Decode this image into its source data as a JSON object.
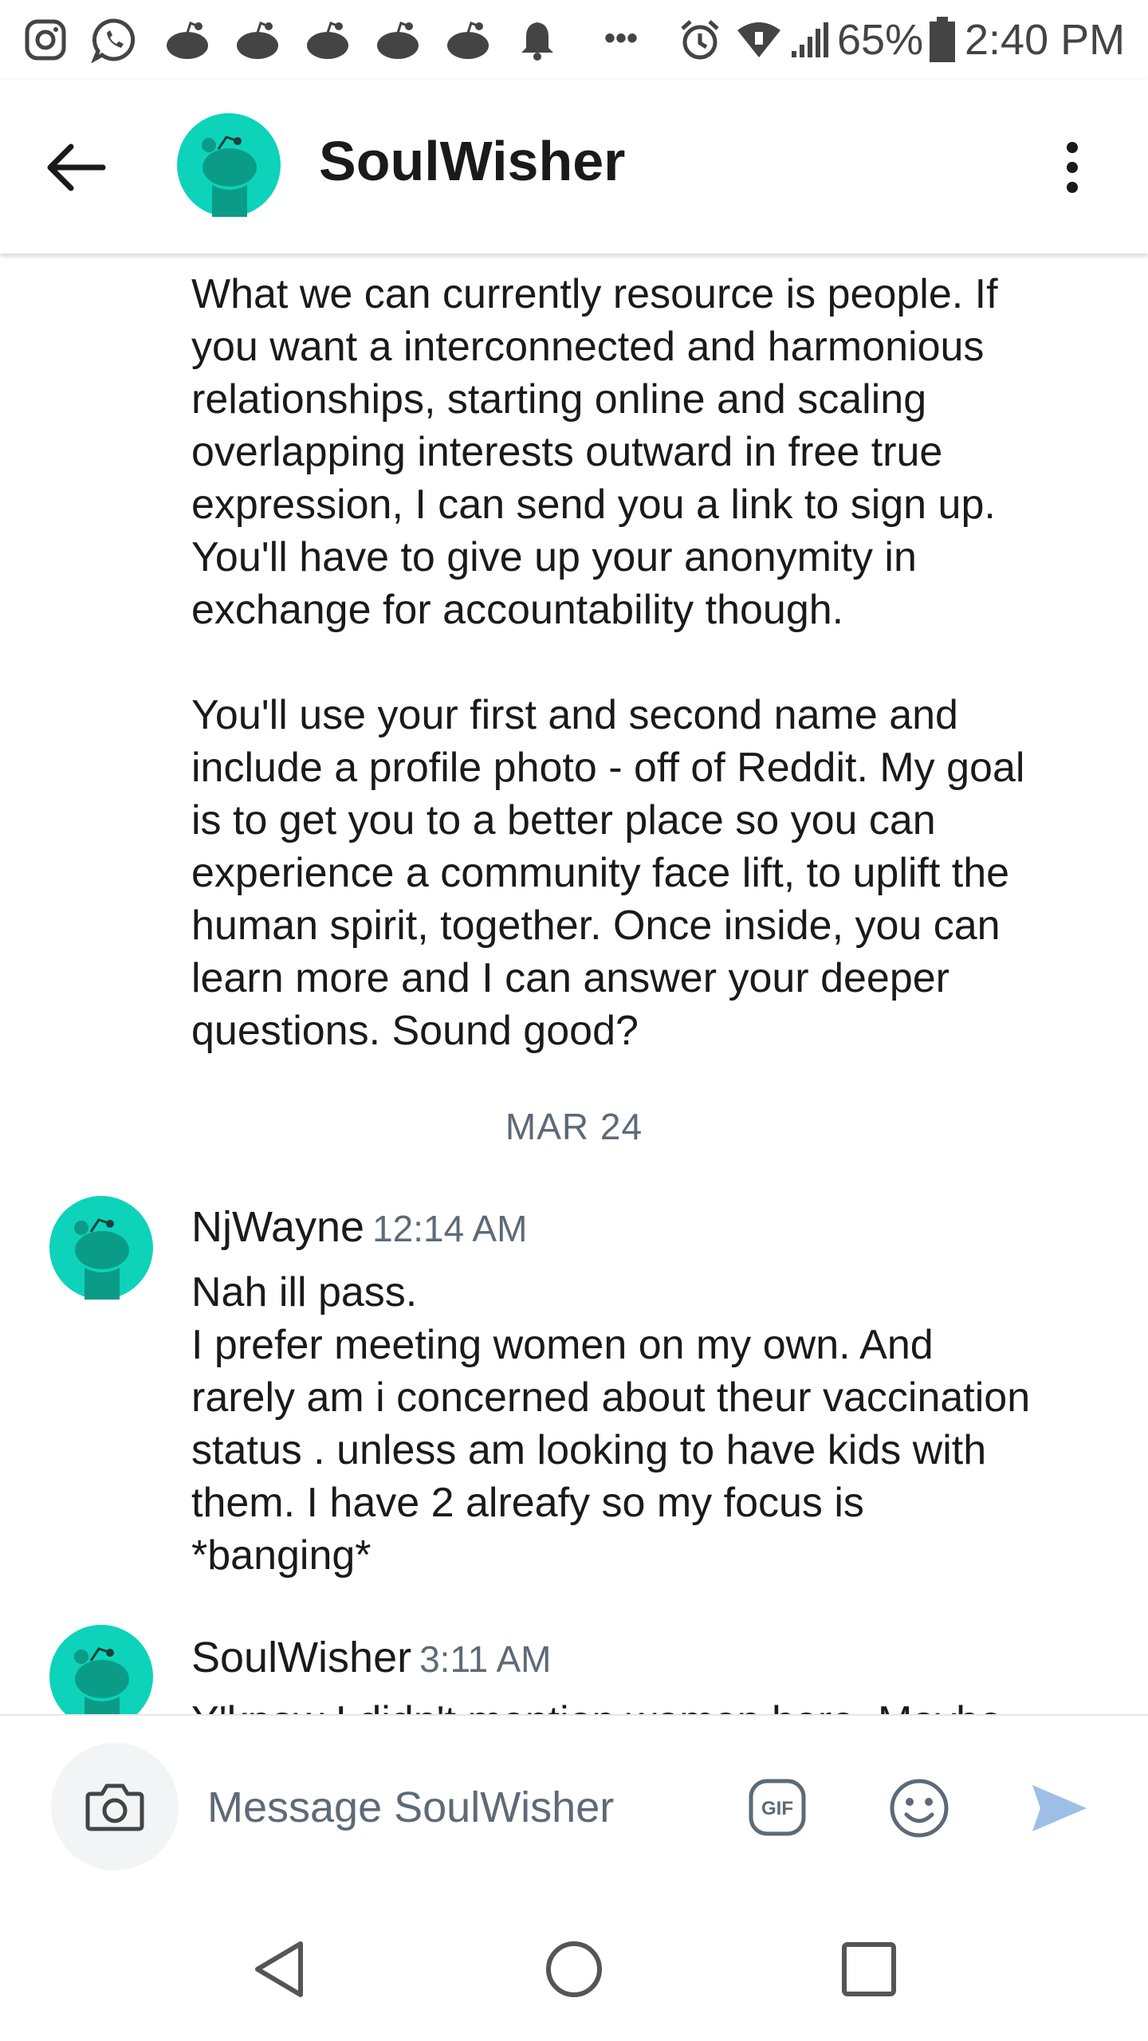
{
  "status_bar": {
    "battery_text": "65%",
    "time": "2:40 PM",
    "more_glyph": "•••",
    "icons": [
      "instagram-icon",
      "whatsapp-icon",
      "reddit-icon",
      "reddit-icon",
      "reddit-icon",
      "reddit-icon",
      "reddit-icon",
      "notification-bell-icon",
      "alarm-icon",
      "wifi-icon",
      "signal-icon",
      "battery-icon"
    ]
  },
  "header": {
    "title": "SoulWisher",
    "back_icon": "arrow-left-icon",
    "menu_icon": "more-vertical-icon"
  },
  "messages": {
    "continued_text": "What we can currently resource is people. If\nyou want a interconnected and harmonious\nrelationships, starting online and scaling\noverlapping interests outward in free true\nexpression, I can send you a link to sign up.\nYou'll have to give up your anonymity in\nexchange for accountability though.\n\nYou'll use your first and second name and\ninclude a profile photo - off of Reddit. My goal\nis to get you to a better place so you can\nexperience a community face lift, to uplift the\nhuman spirit, together. Once inside, you can\nlearn more and I can answer your deeper\nquestions. Sound good?",
    "date_separator": "MAR 24",
    "items": [
      {
        "author": "NjWayne",
        "time": "12:14 AM",
        "text": "Nah ill pass.\nI prefer meeting women on my own. And\nrarely am i concerned about theur vaccination\nstatus . unless am looking to have kids with\nthem. I have 2 alreafy so my focus is\n*banging*"
      },
      {
        "author": "SoulWisher",
        "time": "3:11 AM",
        "text": "Y'know I didn't mention women here. Maybe"
      }
    ]
  },
  "composer": {
    "placeholder": "Message SoulWisher",
    "gif_label": "GIF"
  },
  "colors": {
    "avatar_bg": "#0dd3bb",
    "send_arrow": "#9ebfe6",
    "secondary_text": "#5d6a77"
  }
}
